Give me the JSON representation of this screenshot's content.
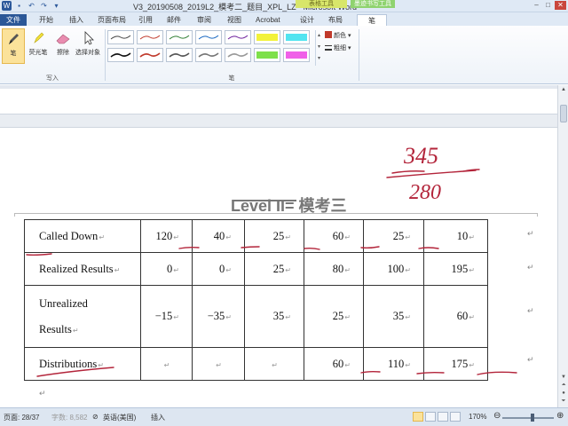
{
  "window": {
    "title": "V3_20190508_2019L2_模考二_题目_XPL_LZ - Microsoft Word",
    "context_tab_1": "表格工具",
    "context_tab_2": "墨迹书写工具"
  },
  "ribbon_tabs": [
    {
      "label": "文件"
    },
    {
      "label": "开始"
    },
    {
      "label": "插入"
    },
    {
      "label": "页面布局"
    },
    {
      "label": "引用"
    },
    {
      "label": "邮件"
    },
    {
      "label": "审阅"
    },
    {
      "label": "视图"
    },
    {
      "label": "Acrobat"
    },
    {
      "label": "设计"
    },
    {
      "label": "布局"
    },
    {
      "label": "笔"
    }
  ],
  "ribbon": {
    "write_tools": [
      {
        "label": "笔",
        "icon": "pen-icon"
      },
      {
        "label": "荧光笔",
        "icon": "highlighter-icon"
      },
      {
        "label": "擦除",
        "icon": "eraser-icon"
      },
      {
        "label": "选择对象",
        "icon": "select-arrow-icon"
      }
    ],
    "group_write_label": "写入",
    "group_pen_label": "笔",
    "color_label": "颜色",
    "weight_label": "粗细",
    "pen_swatches": [
      {
        "stroke": "#444444",
        "fill": "none"
      },
      {
        "stroke": "#c0392b",
        "fill": "none"
      },
      {
        "stroke": "#2e7d32",
        "fill": "none"
      },
      {
        "stroke": "#1565c0",
        "fill": "none"
      },
      {
        "stroke": "#6a1b9a",
        "fill": "none"
      },
      {
        "stroke": "#e6e600",
        "fill": "#f2f23a"
      },
      {
        "stroke": "#2bd9e6",
        "fill": "#52e4f0"
      },
      {
        "stroke": "#111111",
        "fill": "none"
      },
      {
        "stroke": "#c0392b",
        "fill": "none"
      },
      {
        "stroke": "#555555",
        "fill": "none"
      },
      {
        "stroke": "#777777",
        "fill": "none"
      },
      {
        "stroke": "#999999",
        "fill": "none"
      },
      {
        "stroke": "#62d62a",
        "fill": "#7ee04a"
      },
      {
        "stroke": "#e03bd9",
        "fill": "#f060e8"
      }
    ]
  },
  "document": {
    "heading": "Level II= 模考三",
    "table": {
      "rows": [
        {
          "label": "Called Down",
          "values": [
            "120",
            "40",
            "25",
            "60",
            "25",
            "10"
          ]
        },
        {
          "label": "Realized Results",
          "values": [
            "0",
            "0",
            "25",
            "80",
            "100",
            "195"
          ]
        },
        {
          "label": "Unrealized Results",
          "label_line1": "Unrealized",
          "label_line2": "Results",
          "values": [
            "−15",
            "−35",
            "35",
            "25",
            "35",
            "60"
          ]
        },
        {
          "label": "Distributions",
          "values": [
            "",
            "",
            "",
            "60",
            "110",
            "175"
          ]
        }
      ]
    },
    "handwriting": {
      "numerator": "345",
      "denominator": "280",
      "ink_color": "#b3243a"
    }
  },
  "status_bar": {
    "page": "页面: 28/37",
    "word_count": "字数: 8,582",
    "language": "英语(美国)",
    "insert_mode": "插入",
    "zoom": "170%"
  }
}
